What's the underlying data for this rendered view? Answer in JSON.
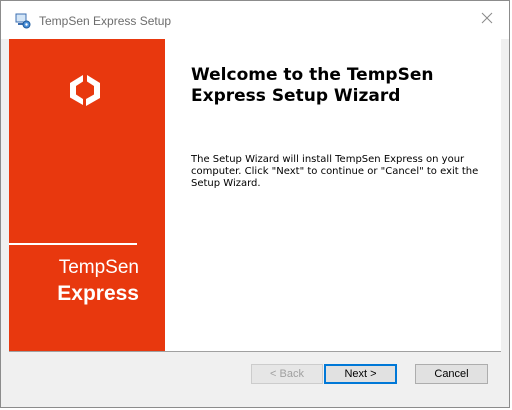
{
  "window": {
    "title": "TempSen Express Setup"
  },
  "icons": {
    "app": "installer-icon",
    "close": "close-icon",
    "logo": "hexagon-logo-icon"
  },
  "colors": {
    "banner": "#e8380e",
    "accent": "#0078d7"
  },
  "banner": {
    "brand_line1": "TempSen",
    "brand_line2": "Express"
  },
  "main": {
    "heading": "Welcome to the TempSen Express Setup Wizard",
    "description": "The Setup Wizard will install TempSen Express on your computer.  Click \"Next\" to continue or \"Cancel\" to exit the Setup Wizard."
  },
  "buttons": {
    "back": "< Back",
    "next": "Next >",
    "cancel": "Cancel"
  }
}
